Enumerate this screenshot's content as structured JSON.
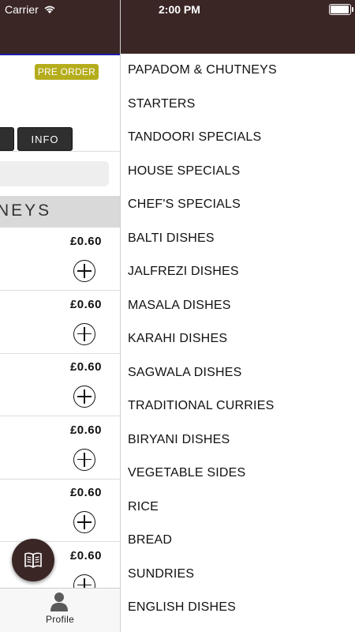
{
  "status_bar": {
    "carrier": "Carrier",
    "time": "2:00 PM"
  },
  "main": {
    "preorder_label": "PRE ORDER",
    "info_label": "INFO",
    "section_title": "NEYS",
    "items": [
      {
        "price": "£0.60"
      },
      {
        "price": "£0.60"
      },
      {
        "price": "£0.60"
      },
      {
        "price": "£0.60"
      },
      {
        "price": "£0.60"
      },
      {
        "price": "£0.60"
      }
    ]
  },
  "tabbar": {
    "profile_label": "Profile"
  },
  "drawer": {
    "categories": [
      "PAPADOM & CHUTNEYS",
      "STARTERS",
      "TANDOORI SPECIALS",
      "HOUSE SPECIALS",
      "CHEF'S SPECIALS",
      "BALTI DISHES",
      "JALFREZI DISHES",
      "MASALA DISHES",
      "KARAHI DISHES",
      "SAGWALA DISHES",
      "TRADITIONAL CURRIES",
      "BIRYANI DISHES",
      "VEGETABLE SIDES",
      "RICE",
      "BREAD",
      "SUNDRIES",
      "ENGLISH DISHES"
    ]
  },
  "theme": {
    "header_color": "#3b2626",
    "preorder_color": "#b5ad1c",
    "info_button_color": "#2f2f2f"
  },
  "icons": {
    "wifi": "wifi-icon",
    "battery": "battery-icon",
    "add": "plus-circle-icon",
    "profile": "person-icon",
    "menu_fab": "open-book-icon"
  }
}
